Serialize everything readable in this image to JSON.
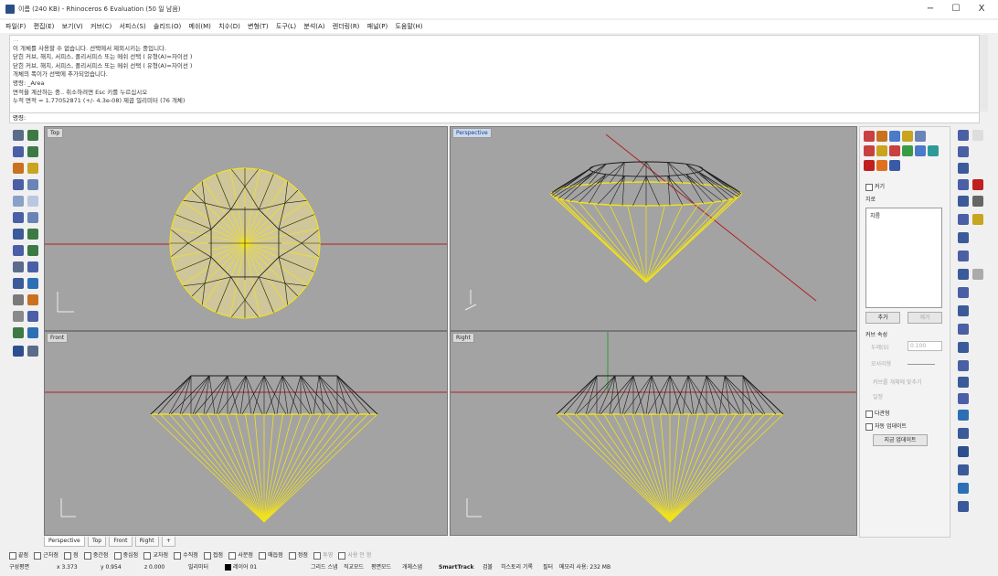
{
  "window": {
    "title": "이름 (240 KB) - Rhinoceros 6 Evaluation (50 일 남음)",
    "minimize": "−",
    "restore": "☐",
    "close": "X"
  },
  "menu": [
    "파일(F)",
    "편집(E)",
    "보기(V)",
    "커브(C)",
    "서피스(S)",
    "솔리드(O)",
    "메쉬(M)",
    "치수(D)",
    "변형(T)",
    "도구(L)",
    "분석(A)",
    "렌더링(R)",
    "패널(P)",
    "도움말(H)"
  ],
  "command_history": [
    "이 개체를 사용할 수 없습니다. 선택에서 제외시키는 중입니다.",
    "닫힌 커브, 해치, 서피스, 폴리서피스 또는 메쉬 선택 ( 유형(A)=자이선 )",
    "닫힌 커브, 해치, 서피스, 폴리서피스 또는 메쉬 선택 ( 유형(A)=자이선 )",
    "개체의 폭이가 선택에 추가되었습니다.",
    "명령: _Area",
    "면적을 계산하는 중.. 취소하려면 Esc 키를 누르십시오",
    "누적 면적 = 1.77052871 (+/- 4.3e-08) 제곱 밀리미터 (76 개체)"
  ],
  "command_prompt": "명령:",
  "viewports": {
    "top": "Top",
    "perspective": "Perspective",
    "front": "Front",
    "right": "Right"
  },
  "viewport_tabs": [
    "Perspective",
    "Top",
    "Front",
    "Right",
    "+"
  ],
  "layer_panel": {
    "object_check": "커기",
    "layer_label": "치로",
    "layer_item": "치름",
    "add_button": "추가",
    "remove_button": "제거",
    "curve_props_header": "커브 속성",
    "thickness_label": "두께(S)",
    "thickness_value": "0.100",
    "taper_label": "모서리형",
    "check_apply": "커브를 개체에 맞추기",
    "check_fit": "일정",
    "polyline_label": "다관형",
    "auto_update": "자동 업데이트",
    "update_button": "지금 업데이트"
  },
  "osnap": [
    "끝점",
    "근처점",
    "점",
    "중간점",
    "중심점",
    "교차점",
    "수직점",
    "접점",
    "사분점",
    "매듭점",
    "정점",
    "투영",
    "사용 안 함"
  ],
  "osnap_dim": [
    "투영",
    "사용 안 함"
  ],
  "status": {
    "cplane": "구성평면",
    "x": "x 3.373",
    "y": "y 0.954",
    "z": "z 0.000",
    "units": "밀리미터",
    "layer": "레이어 01",
    "grid_snap": "그리드 스냅",
    "ortho": "직교모드",
    "planar": "평면모드",
    "osnap": "개체스냅",
    "smarttrack": "SmartTrack",
    "gumball": "검볼",
    "history": "히스토리 기록",
    "filter": "필터",
    "memory": "메모리 사용: 232 MB"
  },
  "colors": {
    "viewport_bg": "#a3a3a3",
    "wire_dark": "#1a1a1a",
    "wire_yellow": "#f2e21c",
    "axis_red": "#b02020",
    "axis_green": "#2f9a3a",
    "active_label": "#cbd9ee"
  }
}
